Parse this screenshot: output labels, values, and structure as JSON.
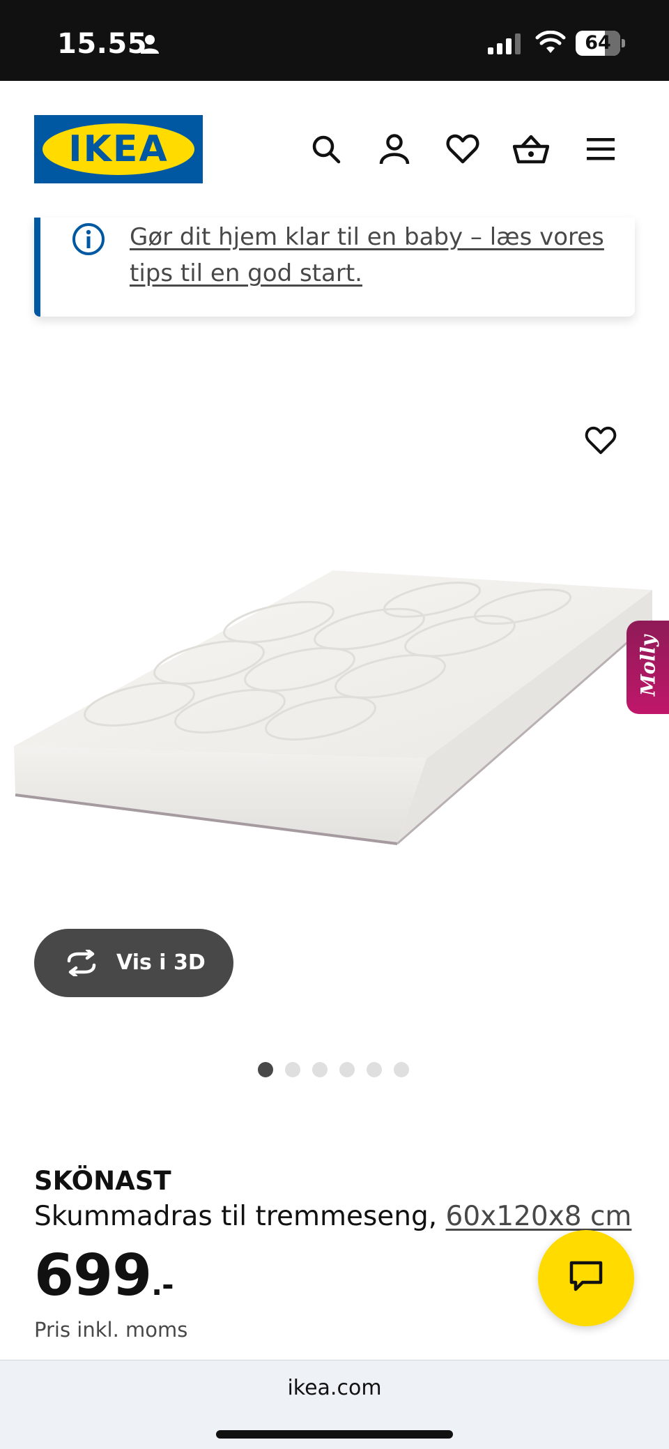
{
  "status_bar": {
    "time": "15.55",
    "battery": "64"
  },
  "header": {
    "logo_text": "IKEA",
    "icons": [
      "search-icon",
      "account-icon",
      "heart-icon",
      "basket-icon",
      "menu-icon"
    ]
  },
  "banner": {
    "link_text": "Gør dit hjem klar til en baby – læs vores tips til en god start."
  },
  "gallery": {
    "view_3d_label": "Vis i 3D",
    "dot_count": 6,
    "active_dot": 1,
    "side_tab_label": "Molly"
  },
  "product": {
    "name": "SKÖNAST",
    "description": "Skummadras til tremmeseng,",
    "size": "60x120x8 cm",
    "price": "699",
    "price_suffix": ".-",
    "price_note": "Pris inkl. moms"
  },
  "browser": {
    "url": "ikea.com"
  },
  "colors": {
    "ikea_blue": "#0058a3",
    "ikea_yellow": "#ffdb00",
    "dark_button": "#484848",
    "molly_pink": "#c0176a"
  }
}
